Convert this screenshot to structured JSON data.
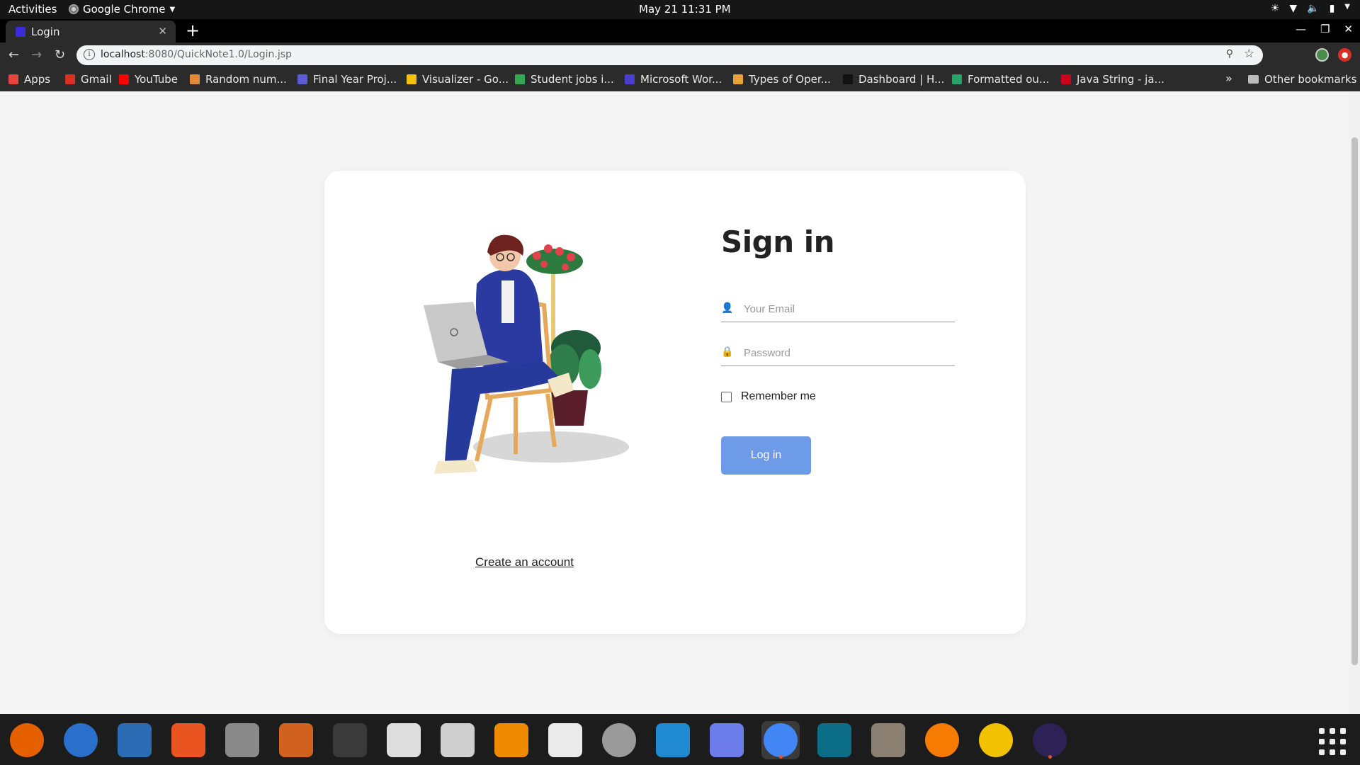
{
  "topbar": {
    "activities": "Activities",
    "app_menu": "Google Chrome",
    "clock": "May 21  11:31 PM"
  },
  "chrome": {
    "tab_title": "Login",
    "url_host": "localhost",
    "url_path": ":8080/QuickNote1.0/Login.jsp",
    "bookmarks": [
      {
        "label": "Apps",
        "color": "#e8453c"
      },
      {
        "label": "Gmail",
        "color": "#d93025"
      },
      {
        "label": "YouTube",
        "color": "#ff0000"
      },
      {
        "label": "Random num...",
        "color": "#e08a3a"
      },
      {
        "label": "Final Year Proj...",
        "color": "#5b5bd6"
      },
      {
        "label": "Visualizer - Go...",
        "color": "#f4c20d"
      },
      {
        "label": "Student jobs i...",
        "color": "#34a853"
      },
      {
        "label": "Microsoft Wor...",
        "color": "#4b3fcf"
      },
      {
        "label": "Types of Oper...",
        "color": "#e8a33a"
      },
      {
        "label": "Dashboard | H...",
        "color": "#111111"
      },
      {
        "label": "Formatted ou...",
        "color": "#2aa36a"
      },
      {
        "label": "Java String - ja...",
        "color": "#d0021b"
      }
    ],
    "other_bookmarks": "Other bookmarks"
  },
  "page": {
    "title": "Sign in",
    "email_placeholder": "Your Email",
    "password_placeholder": "Password",
    "remember_label": "Remember me",
    "login_button": "Log in",
    "create_account_link": "Create an account"
  },
  "dock": {
    "apps": [
      {
        "name": "firefox",
        "color": "#e66000"
      },
      {
        "name": "thunderbird",
        "color": "#2a6fc9"
      },
      {
        "name": "libreoffice-writer",
        "color": "#2b6cb5"
      },
      {
        "name": "ubuntu-software",
        "color": "#e95420"
      },
      {
        "name": "database",
        "color": "#8a8a8a"
      },
      {
        "name": "libreoffice-impress",
        "color": "#d1611f"
      },
      {
        "name": "terminal",
        "color": "#3a3a3a"
      },
      {
        "name": "files",
        "color": "#ddd"
      },
      {
        "name": "image-viewer",
        "color": "#cfcfcf"
      },
      {
        "name": "vlc",
        "color": "#f08a00"
      },
      {
        "name": "text-editor",
        "color": "#eaeaea"
      },
      {
        "name": "settings",
        "color": "#9a9a9a"
      },
      {
        "name": "vscode",
        "color": "#1f8ad2"
      },
      {
        "name": "screenshot",
        "color": "#6c7ce8"
      },
      {
        "name": "chrome",
        "color": "#4285f4"
      },
      {
        "name": "intellij",
        "color": "#0b6e86"
      },
      {
        "name": "gimp",
        "color": "#8a7f70"
      },
      {
        "name": "blender",
        "color": "#f57c00"
      },
      {
        "name": "rhythmbox",
        "color": "#f2c200"
      },
      {
        "name": "eclipse",
        "color": "#2c2255"
      }
    ]
  }
}
